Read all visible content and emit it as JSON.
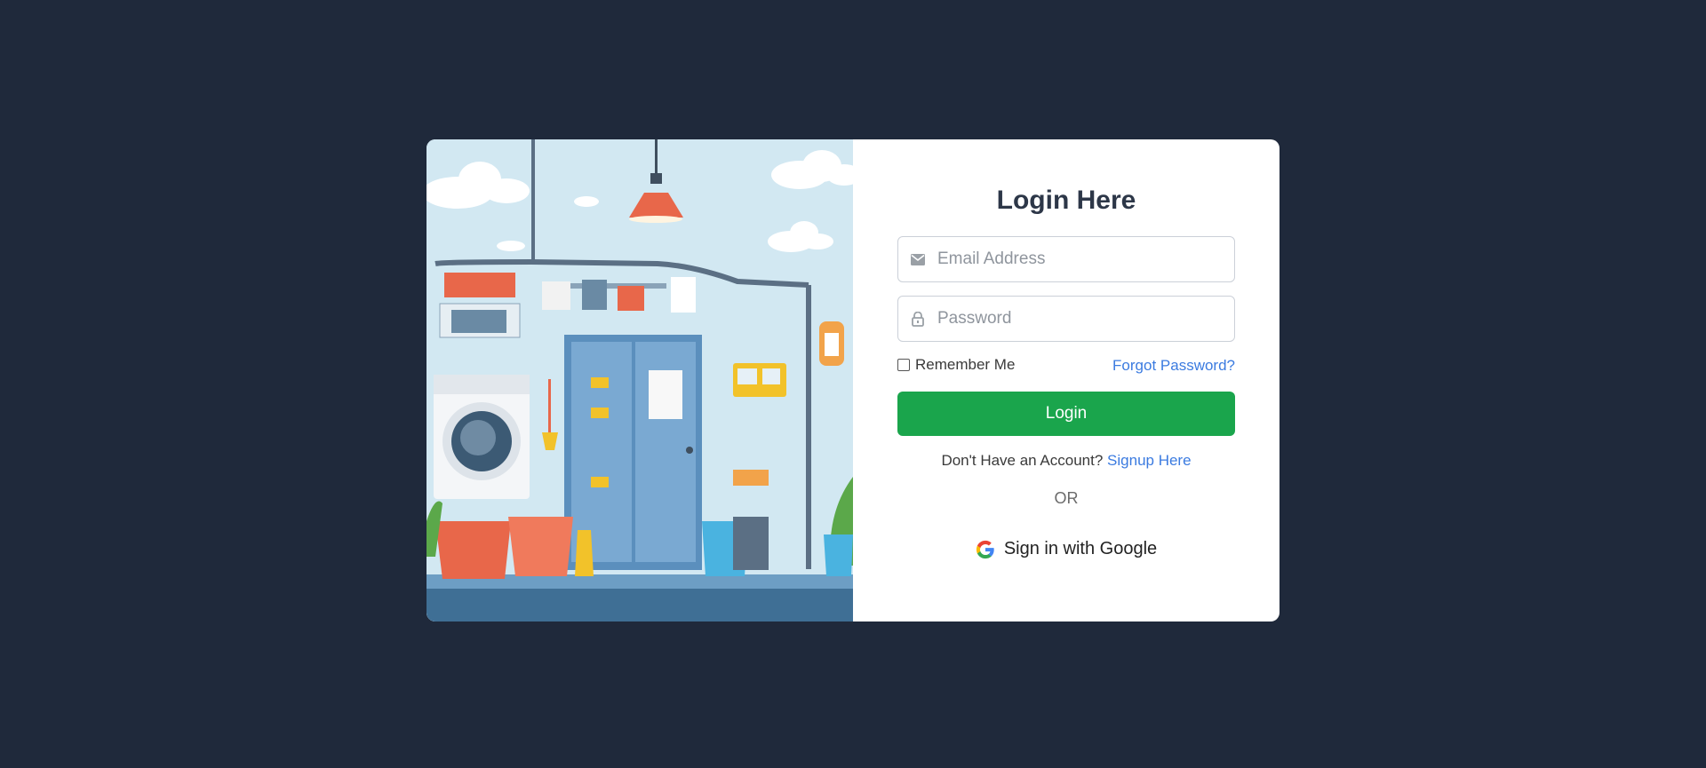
{
  "login": {
    "title": "Login Here",
    "email": {
      "placeholder": "Email Address",
      "icon": "mail-icon"
    },
    "password": {
      "placeholder": "Password",
      "icon": "lock-icon"
    },
    "remember_label": "Remember Me",
    "forgot_label": "Forgot Password?",
    "login_button_label": "Login",
    "signup_prompt": "Don't Have an Account?",
    "signup_link": "Signup Here",
    "divider": "OR",
    "google_button_label": "Sign in with Google"
  },
  "colors": {
    "background": "#1f293b",
    "primary_button": "#1aa54c",
    "link": "#3b7be0",
    "heading": "#2d3748"
  }
}
